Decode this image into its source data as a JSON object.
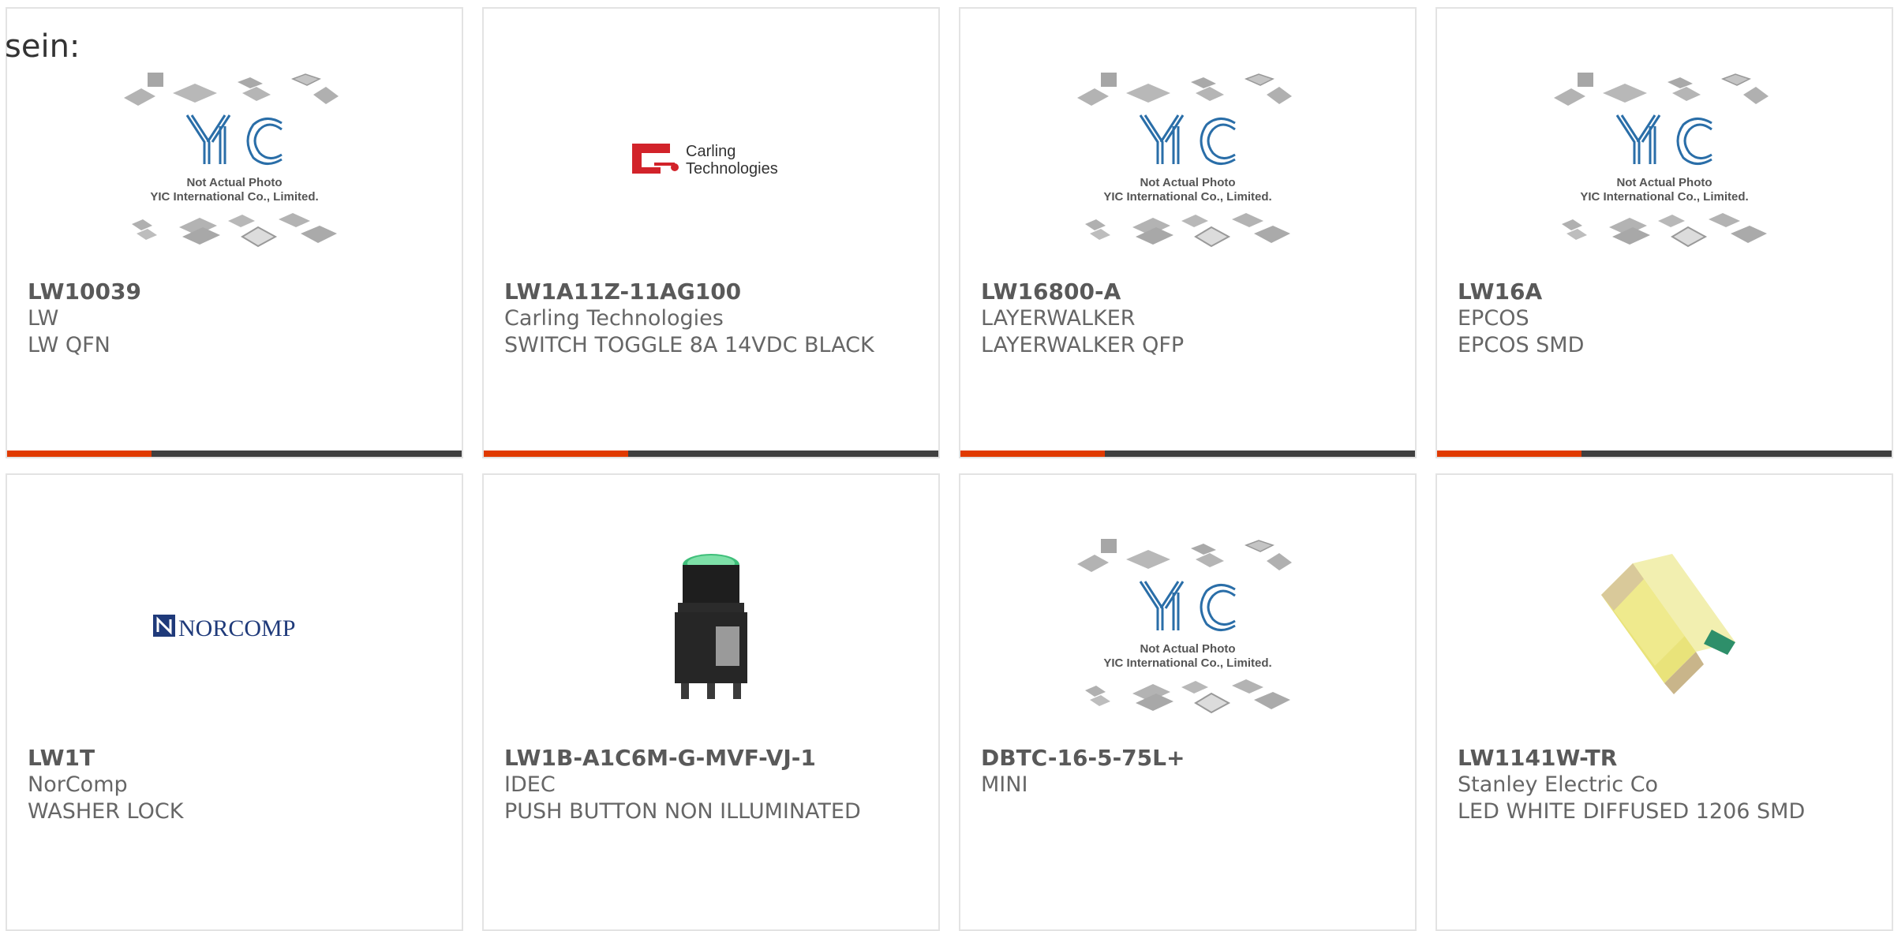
{
  "intro": "sein:",
  "colors": {
    "accent": "#e03a00",
    "bar": "#404040",
    "border": "#e3e3e3"
  },
  "placeholder": {
    "logo": "YIC",
    "line1": "Not Actual Photo",
    "line2": "YIC International Co., Limited."
  },
  "carling_logo": {
    "line1": "Carling",
    "line2": "Technologies"
  },
  "norcomp_logo": "NORCOMP",
  "products": [
    {
      "part": "LW10039",
      "mfr": "LW",
      "desc": "LW QFN"
    },
    {
      "part": "LW1A11Z-11AG100",
      "mfr": "Carling Technologies",
      "desc": "SWITCH TOGGLE 8A 14VDC BLACK"
    },
    {
      "part": "LW16800-A",
      "mfr": "LAYERWALKER",
      "desc": "LAYERWALKER QFP"
    },
    {
      "part": "LW16A",
      "mfr": "EPCOS",
      "desc": "EPCOS SMD"
    },
    {
      "part": "LW1T",
      "mfr": "NorComp",
      "desc": "WASHER LOCK"
    },
    {
      "part": "LW1B-A1C6M-G-MVF-VJ-1",
      "mfr": "IDEC",
      "desc": "PUSH BUTTON NON ILLUMINATED"
    },
    {
      "part": "DBTC-16-5-75L+",
      "mfr": "MINI",
      "desc": ""
    },
    {
      "part": "LW1141W-TR",
      "mfr": "Stanley Electric Co",
      "desc": "LED WHITE DIFFUSED 1206 SMD"
    }
  ]
}
